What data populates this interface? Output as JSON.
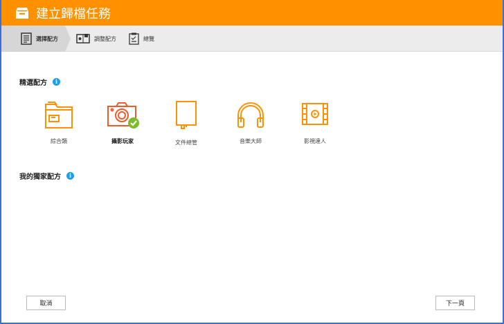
{
  "window": {
    "title": "建立歸檔任務"
  },
  "steps": [
    {
      "label": "選擇配方",
      "active": true
    },
    {
      "label": "調整配方",
      "active": false
    },
    {
      "label": "總覽",
      "active": false
    }
  ],
  "sections": {
    "featured": "精選配方",
    "mine": "我的獨家配方",
    "info_glyph": "i"
  },
  "recipes": [
    {
      "label": "綜合類",
      "icon": "folder-icon",
      "selected": false
    },
    {
      "label": "攝影玩家",
      "icon": "camera-icon",
      "selected": true
    },
    {
      "label": "文件總管",
      "icon": "book-icon",
      "selected": false
    },
    {
      "label": "音樂大師",
      "icon": "headphones-icon",
      "selected": false
    },
    {
      "label": "影視達人",
      "icon": "film-icon",
      "selected": false
    }
  ],
  "buttons": {
    "cancel": "取消",
    "next": "下一頁"
  },
  "colors": {
    "accent": "#ff9100",
    "selected_icon": "#f05a28",
    "check": "#7cbb2b",
    "info": "#1e9df0",
    "border": "#3b6fd6"
  }
}
